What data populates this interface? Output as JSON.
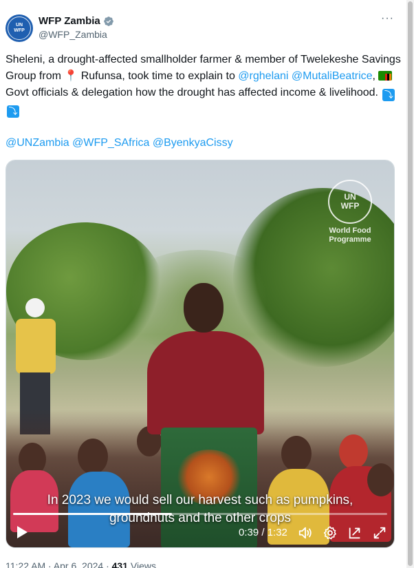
{
  "author": {
    "display_name": "WFP Zambia",
    "handle": "@WFP_Zambia",
    "avatar_text": [
      "UN",
      "WFP"
    ],
    "verified_color": "#829aab"
  },
  "more_button": "···",
  "post": {
    "segments": [
      {
        "t": "Sheleni, a drought-affected smallholder farmer & member of Twelekeshe Savings Group from "
      },
      {
        "pin": "📍"
      },
      {
        "t": " Rufunsa, took time to explain to "
      },
      {
        "link": "@rghelani"
      },
      {
        "t": " "
      },
      {
        "link": "@MutaliBeatrice"
      },
      {
        "t": ", "
      },
      {
        "flag": "zambia-flag"
      },
      {
        "t": "Govt officials & delegation how the drought has affected income & livelihood. "
      },
      {
        "emoji": "⤵"
      },
      {
        "emoji": "⤵"
      }
    ],
    "mentions": "@UNZambia @WFP_SAfrica @ByenkyaCissy"
  },
  "video": {
    "watermark": {
      "mark": [
        "UN",
        "WFP"
      ],
      "text": [
        "World Food",
        "Programme"
      ]
    },
    "caption_lines": [
      "In 2023 we would sell our harvest such as pumpkins,",
      "groundnuts and the other crops"
    ],
    "time": "0:39 / 1:32",
    "progress": 0.424,
    "icons": {
      "play": "play-icon",
      "volume": "volume-icon",
      "settings": "gear-icon",
      "pip": "pip-icon",
      "fullscreen": "fullscreen-icon"
    }
  },
  "meta": {
    "time": "11:22 AM",
    "sep1": " · ",
    "date": "Apr 6, 2024",
    "sep2": " · ",
    "views_count": "431",
    "views_label": " Views"
  },
  "colors": {
    "link": "#1d9bf0",
    "text": "#0f1419",
    "muted": "#536471"
  }
}
